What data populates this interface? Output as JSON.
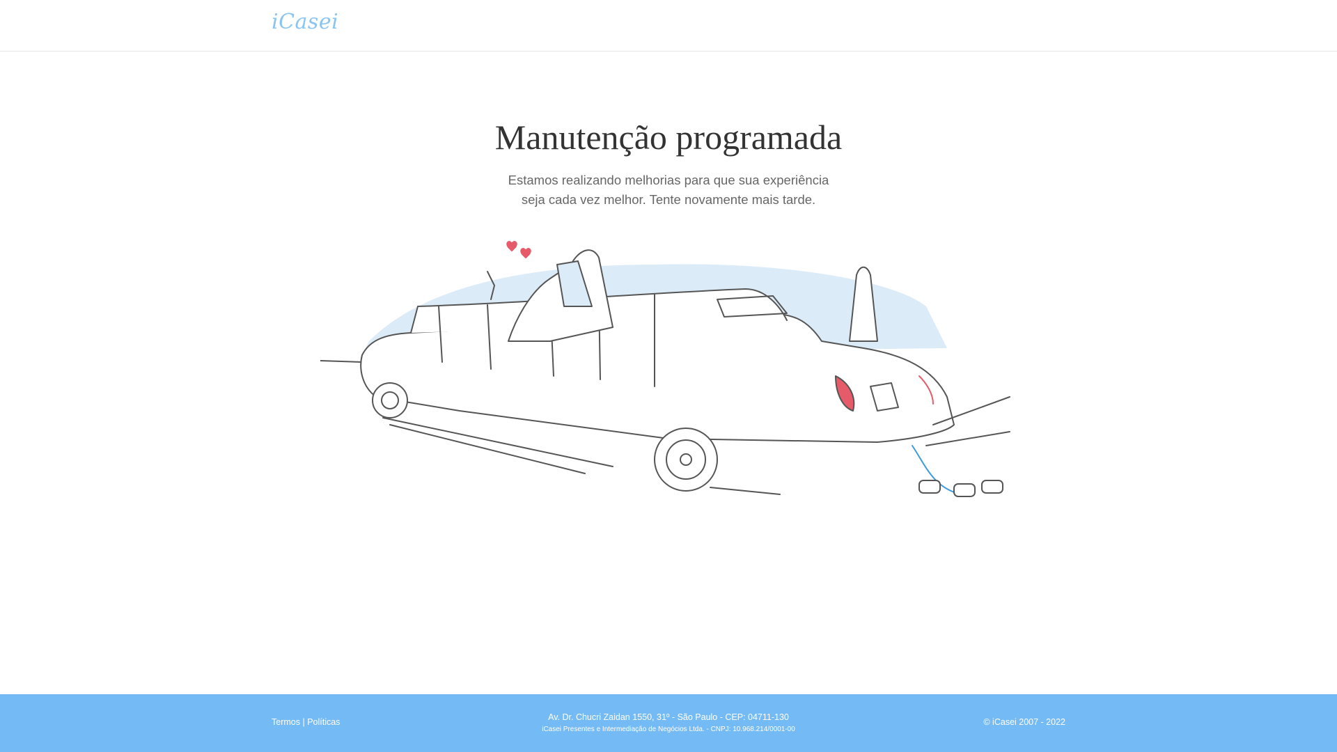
{
  "header": {
    "logo": "iCasei"
  },
  "main": {
    "title": "Manutenção programada",
    "subtitle_line1": "Estamos realizando melhorias para que sua experiência",
    "subtitle_line2": "seja cada vez melhor. Tente novamente mais tarde."
  },
  "footer": {
    "terms": "Termos",
    "separator": " | ",
    "policies": "Políticas",
    "address": "Av. Dr. Chucri Zaidan 1550, 31º - São Paulo - CEP: 04711-130",
    "company": "iCasei Presentes e Intermediação de Negócios Ltda. - CNPJ: 10.968.214/0001-00",
    "copyright": "© iCasei 2007 - 2022"
  },
  "colors": {
    "brand": "#74baf4",
    "logo": "#8ac4f2",
    "sky": "#dcebf8"
  }
}
